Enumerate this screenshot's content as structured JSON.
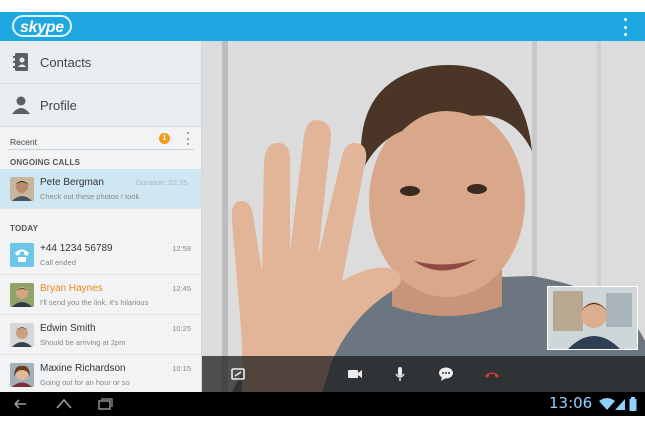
{
  "app": {
    "logo_text": "skype",
    "accent_color": "#1ea7e1",
    "overflow_icon": "overflow-menu-icon"
  },
  "nav": {
    "contacts_label": "Contacts",
    "contacts_icon": "contacts-book-icon",
    "profile_label": "Profile",
    "profile_icon": "person-icon"
  },
  "recent": {
    "label": "Recent",
    "badge_count": "1",
    "ongoing_header": "ONGOING CALLS",
    "today_header": "TODAY"
  },
  "ongoing_calls": [
    {
      "name": "Pete Bergman",
      "message": "Check out these photos I took",
      "duration": "Duration: 02:15",
      "avatar_icon": "contact-photo"
    }
  ],
  "today": [
    {
      "name": "+44 1234 56789",
      "message": "Call ended",
      "time": "12:58",
      "avatar_icon": "phone-icon"
    },
    {
      "name": "Bryan Haynes",
      "message": "I'll send you the link, it's hilarious",
      "time": "12:45",
      "avatar_icon": "contact-photo",
      "name_color": "#e88a1a"
    },
    {
      "name": "Edwin Smith",
      "message": "Should be arriving at 2pm",
      "time": "10:25",
      "avatar_icon": "contact-photo"
    },
    {
      "name": "Maxine Richardson",
      "message": "Going out for an hour or so",
      "time": "10:15",
      "avatar_icon": "contact-photo"
    }
  ],
  "call_controls": [
    {
      "name": "fullscreen-icon"
    },
    {
      "name": "video-camera-icon"
    },
    {
      "name": "microphone-icon"
    },
    {
      "name": "chat-bubble-icon"
    },
    {
      "name": "end-call-icon"
    }
  ],
  "system_bar": {
    "clock": "13:06",
    "status_color": "#8fd1ff",
    "icons": [
      "back-icon",
      "home-icon",
      "recent-apps-icon",
      "wifi-icon",
      "signal-icon",
      "battery-icon"
    ]
  }
}
